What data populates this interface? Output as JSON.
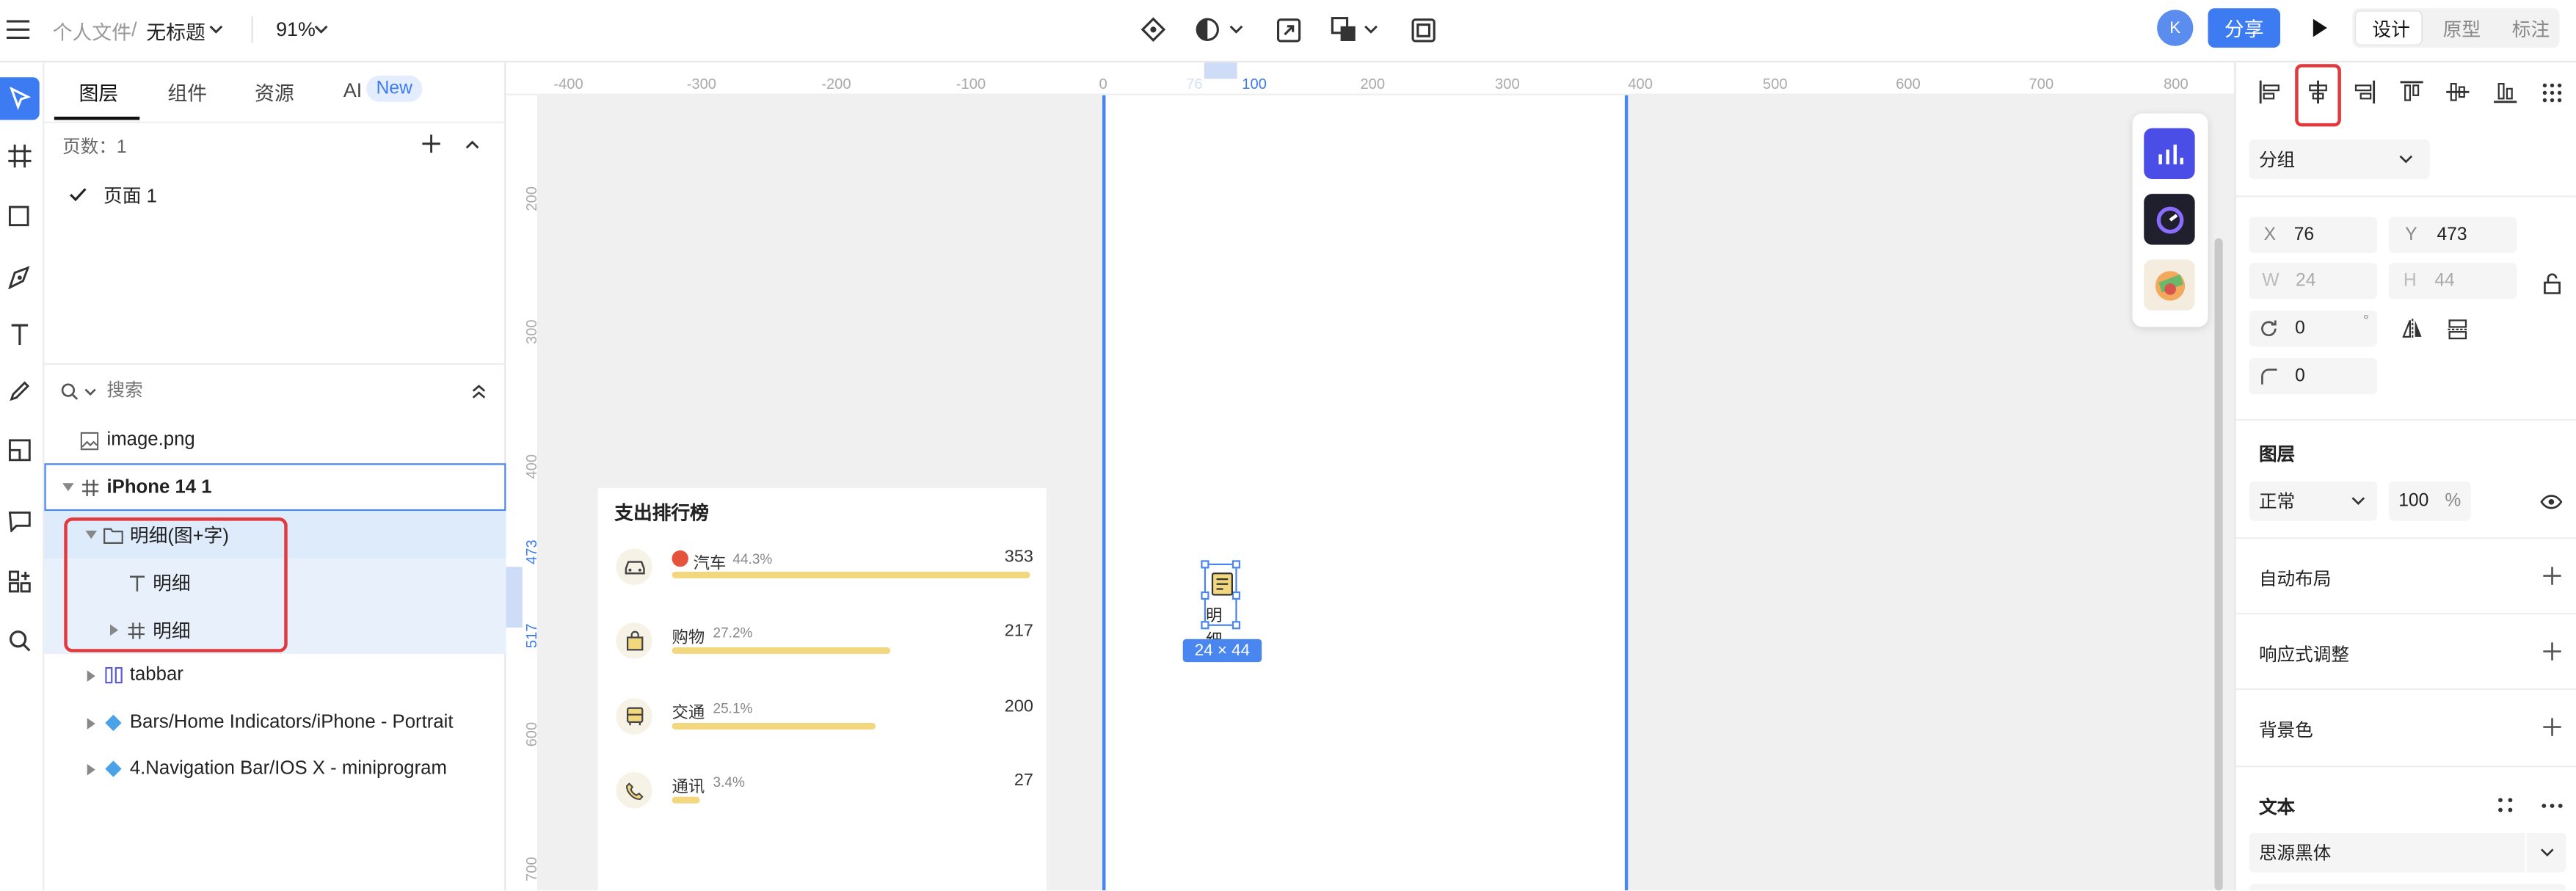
{
  "topbar": {
    "breadcrumb_parent": "个人文件",
    "breadcrumb_sep": "/",
    "file_name": "无标题",
    "zoom": "91%",
    "avatar_initial": "K",
    "share": "分享",
    "mode_tabs": [
      "设计",
      "原型",
      "标注"
    ]
  },
  "left_panel": {
    "tabs": [
      "图层",
      "组件",
      "资源",
      "AI"
    ],
    "ai_badge": "New",
    "pages_label": "页数：1",
    "page_item": "页面 1",
    "search_placeholder": "搜索",
    "layers": [
      "image.png",
      "iPhone 14 1",
      "明细(图+字)",
      "明细",
      "明细",
      "tabbar",
      "Bars/Home Indicators/iPhone - Portrait",
      "4.Navigation Bar/IOS X - miniprogram"
    ]
  },
  "ruler": {
    "top": [
      "-400",
      "-300",
      "-200",
      "-100",
      "0",
      "76",
      "100",
      "200",
      "300",
      "400",
      "500",
      "600",
      "700",
      "800"
    ],
    "left": [
      "200",
      "300",
      "400",
      "473",
      "517",
      "600",
      "700"
    ]
  },
  "card": {
    "title": "支出排行榜",
    "items": [
      {
        "name": "汽车",
        "pct": "44.3%",
        "value": "353",
        "ratio": 1.0
      },
      {
        "name": "购物",
        "pct": "27.2%",
        "value": "217",
        "ratio": 0.61
      },
      {
        "name": "交通",
        "pct": "25.1%",
        "value": "200",
        "ratio": 0.57
      },
      {
        "name": "通讯",
        "pct": "3.4%",
        "value": "27",
        "ratio": 0.08
      }
    ]
  },
  "selection": {
    "label": "明细",
    "size": "24 × 44"
  },
  "right_panel": {
    "group_select": "分组",
    "x_label": "X",
    "x_value": "76",
    "y_label": "Y",
    "y_value": "473",
    "w_label": "W",
    "w_value": "24",
    "h_label": "H",
    "h_value": "44",
    "rotation": "0",
    "degree": "°",
    "radius": "0",
    "layer_section": "图层",
    "blend": "正常",
    "opacity": "100",
    "percent": "%",
    "sections": [
      "自动布局",
      "响应式调整",
      "背景色"
    ],
    "text_section": "文本",
    "font": "思源黑体"
  },
  "colors": {
    "accent": "#3d7bf2",
    "selection_red": "#e0393e",
    "bar": "#f2d77f"
  }
}
